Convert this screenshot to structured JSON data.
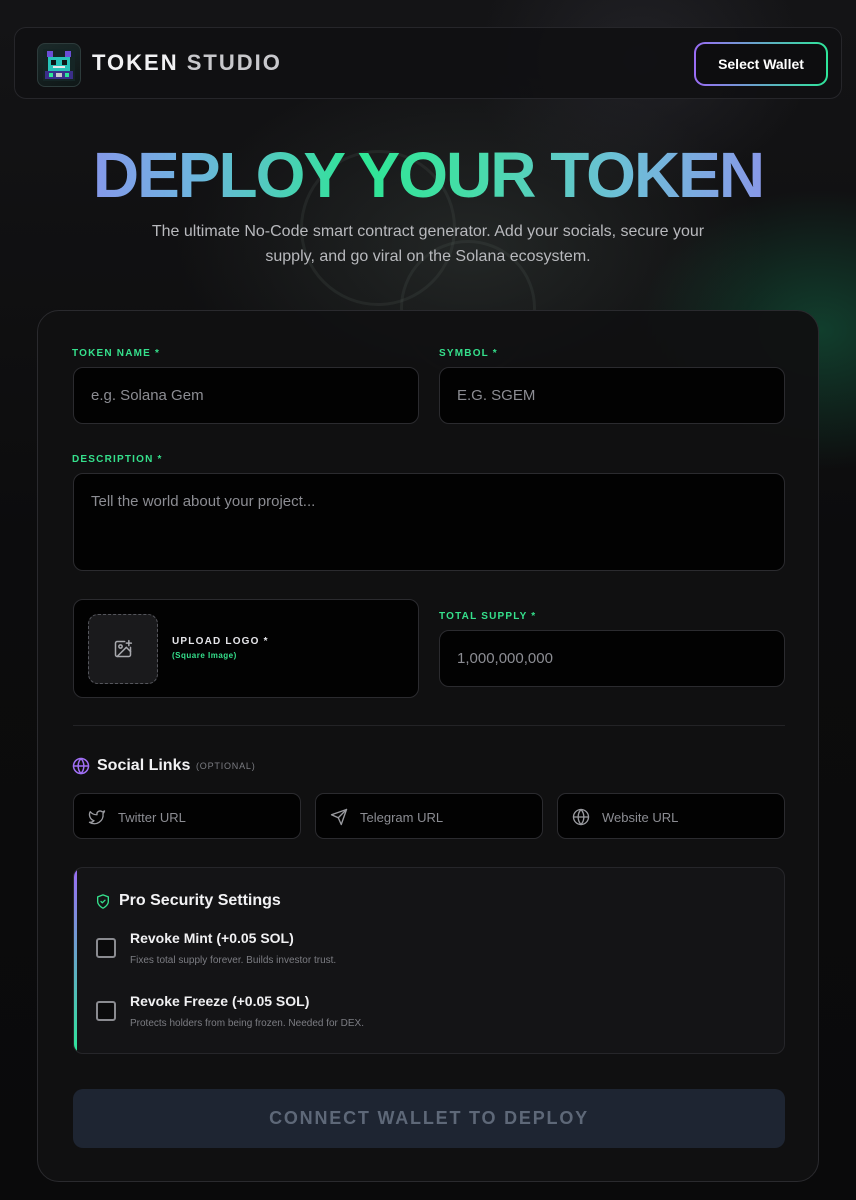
{
  "header": {
    "brand_part1": "TOKEN",
    "brand_part2": "STUDIO",
    "logo_icon": "pixel-robot-logo-icon",
    "wallet_button": "Select Wallet"
  },
  "hero": {
    "title": "DEPLOY YOUR TOKEN",
    "subtitle": "The ultimate No-Code smart contract generator. Add your socials, secure your supply, and go viral on the Solana ecosystem."
  },
  "form": {
    "token_name": {
      "label": "TOKEN NAME *",
      "placeholder": "e.g. Solana Gem",
      "value": ""
    },
    "symbol": {
      "label": "SYMBOL *",
      "placeholder": "E.G. SGEM",
      "value": ""
    },
    "description": {
      "label": "DESCRIPTION *",
      "placeholder": "Tell the world about your project...",
      "value": ""
    },
    "upload": {
      "label": "UPLOAD LOGO *",
      "hint": "(Square Image)",
      "icon": "image-plus-icon"
    },
    "total_supply": {
      "label": "TOTAL SUPPLY *",
      "placeholder": "1,000,000,000",
      "value": ""
    }
  },
  "social": {
    "title": "Social Links",
    "optional": "(OPTIONAL)",
    "icon": "globe-icon",
    "fields": [
      {
        "placeholder": "Twitter URL",
        "icon": "twitter-icon"
      },
      {
        "placeholder": "Telegram URL",
        "icon": "telegram-icon"
      },
      {
        "placeholder": "Website URL",
        "icon": "globe-icon"
      }
    ]
  },
  "security": {
    "title": "Pro Security Settings",
    "icon": "shield-check-icon",
    "options": [
      {
        "title": "Revoke Mint (+0.05 SOL)",
        "desc": "Fixes total supply forever. Builds investor trust.",
        "checked": false
      },
      {
        "title": "Revoke Freeze (+0.05 SOL)",
        "desc": "Protects holders from being frozen. Needed for DEX.",
        "checked": false
      }
    ]
  },
  "deploy_button": "CONNECT WALLET TO DEPLOY",
  "colors": {
    "accent_green": "#35e08c",
    "accent_purple": "#9a6cf5",
    "background": "#0b0b0c",
    "card": "#111112",
    "deploy_button_bg": "#1e2532"
  }
}
